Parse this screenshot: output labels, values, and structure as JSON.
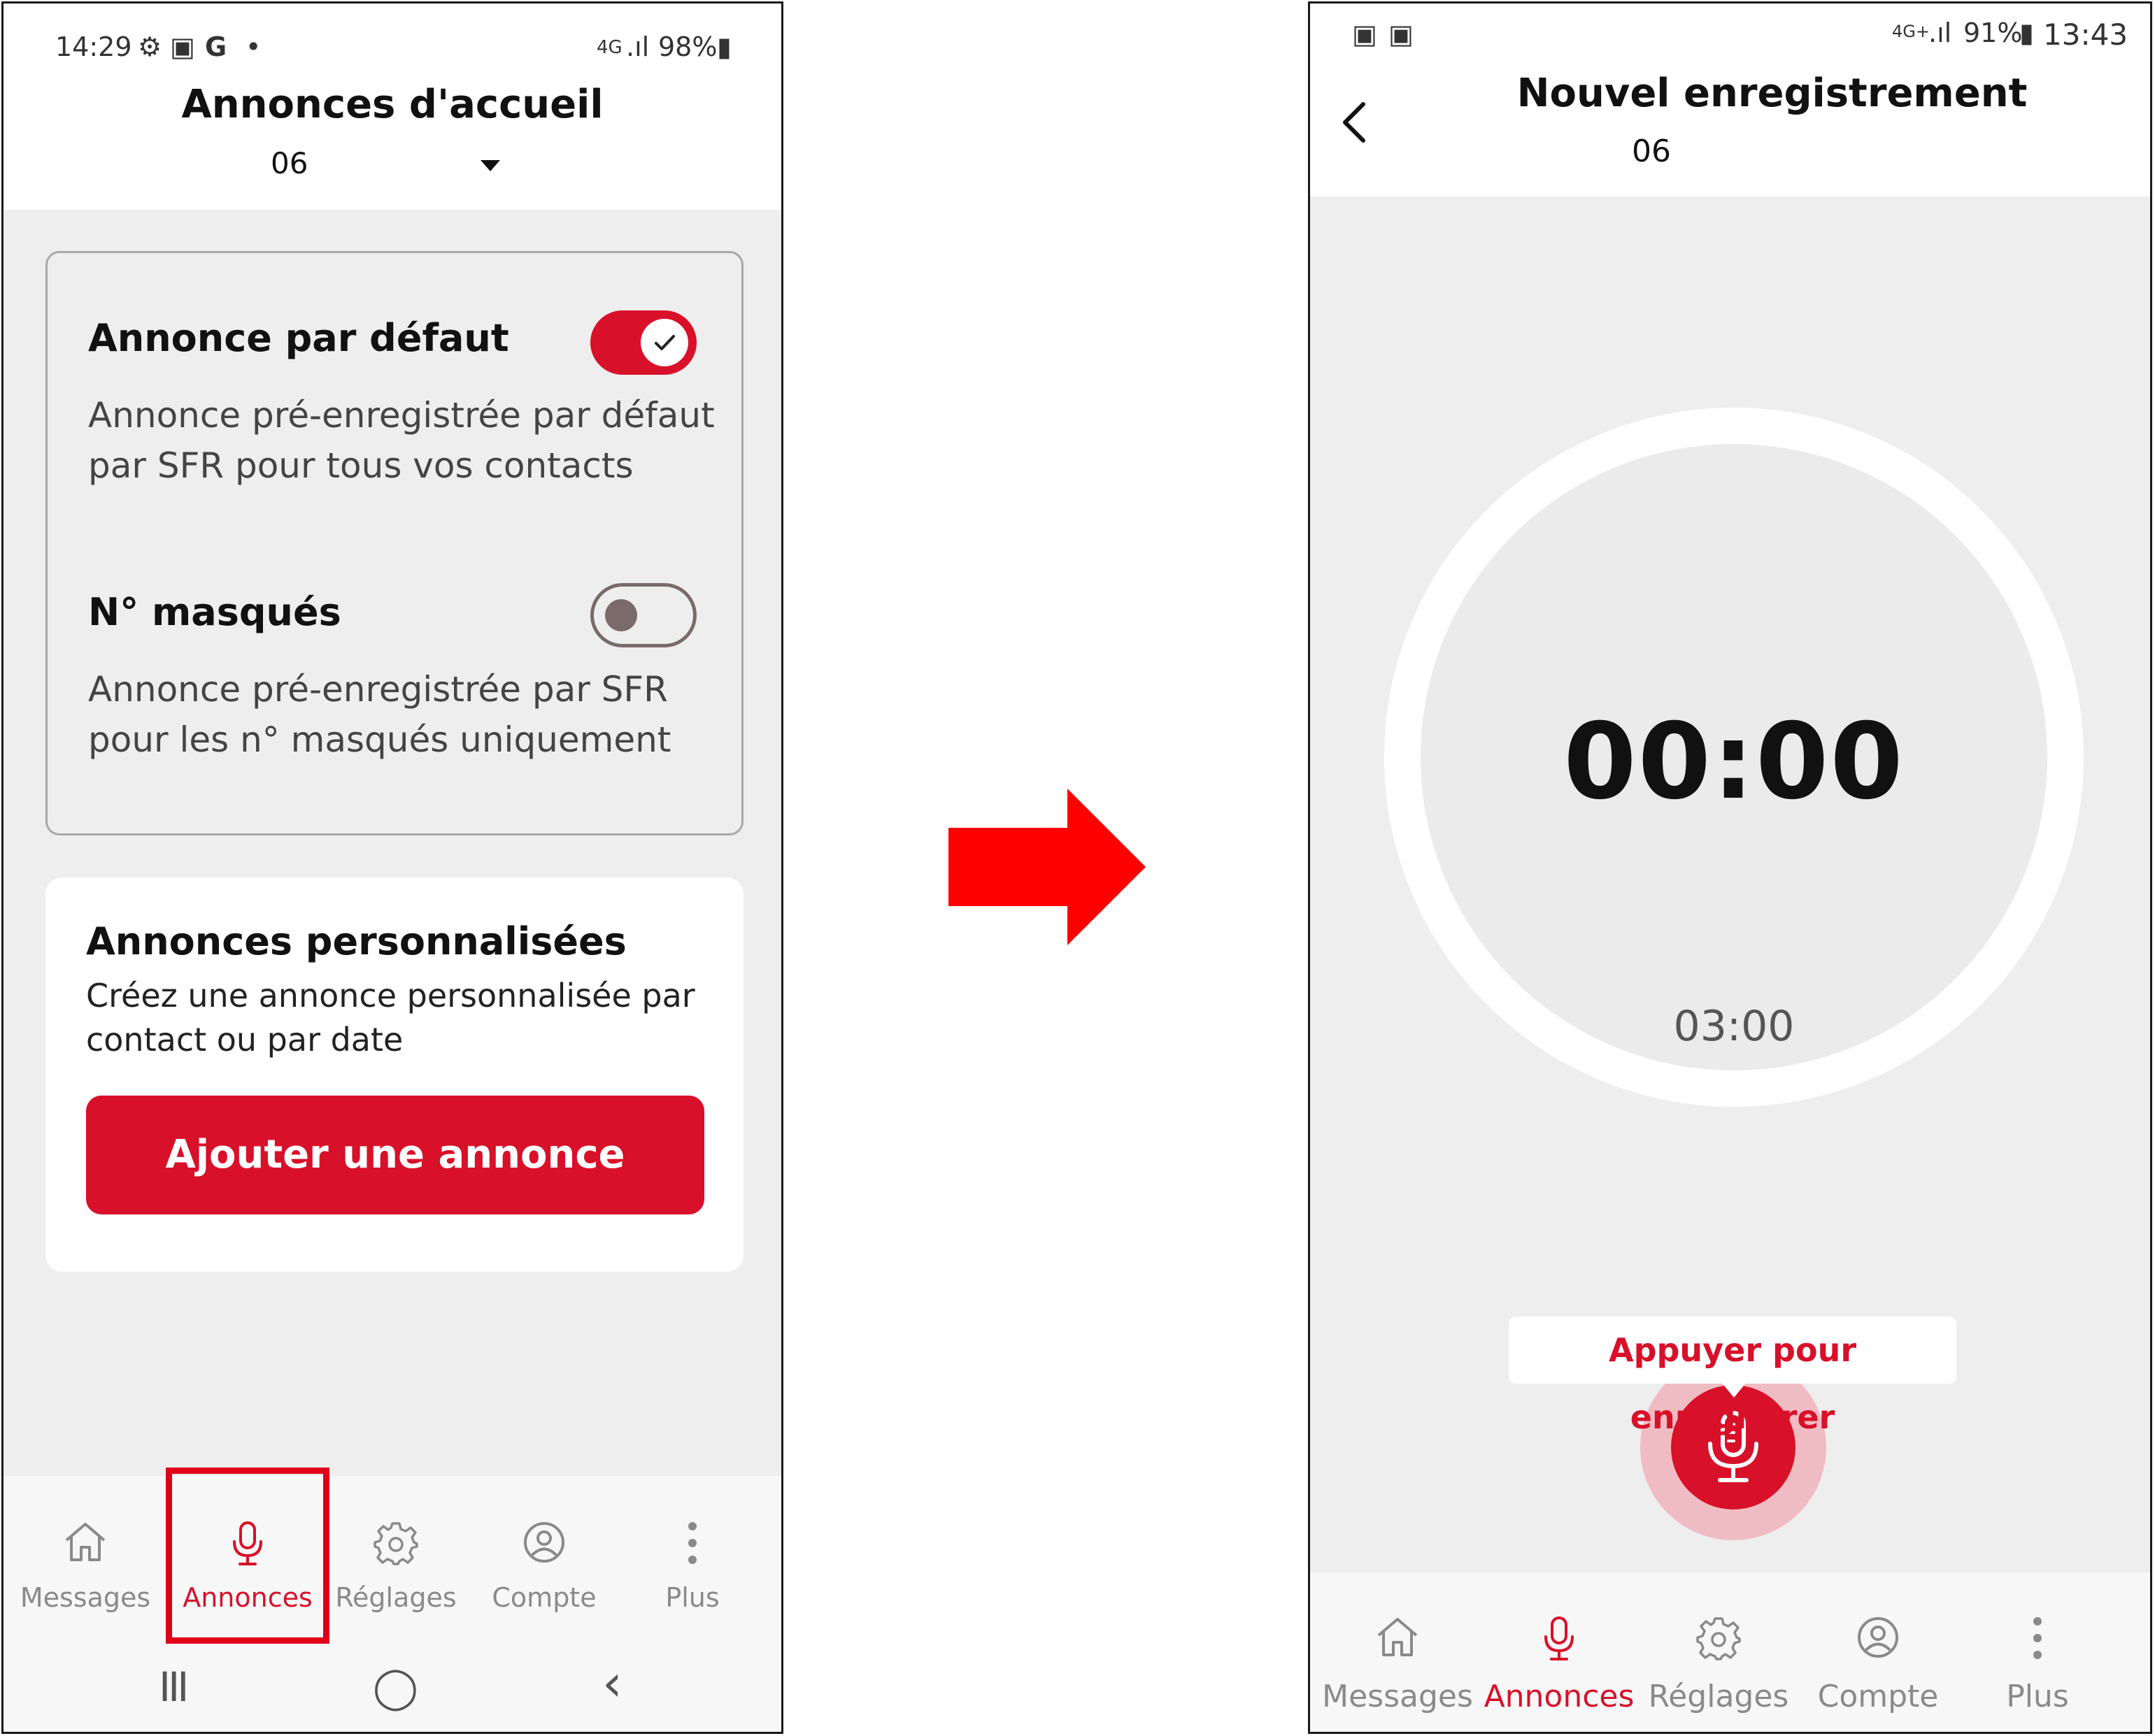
{
  "left_screen": {
    "status": {
      "time": "14:29",
      "network": "4G",
      "battery": "98%"
    },
    "header": {
      "title": "Annonces d'accueil",
      "line_number": "06"
    },
    "default_card": {
      "option1": {
        "title": "Annonce par défaut",
        "description": "Annonce pré-enregistrée par défaut par SFR pour tous vos contacts",
        "enabled": true
      },
      "option2": {
        "title": "N° masqués",
        "description": "Annonce pré-enregistrée par SFR pour les n° masqués uniquement",
        "enabled": false
      }
    },
    "custom_card": {
      "title": "Annonces personnalisées",
      "description": "Créez une annonce personnalisée par contact ou par date",
      "button_label": "Ajouter une annonce"
    },
    "nav": [
      {
        "label": "Messages",
        "icon": "home-icon"
      },
      {
        "label": "Annonces",
        "icon": "microphone-icon",
        "active": true
      },
      {
        "label": "Réglages",
        "icon": "gear-icon"
      },
      {
        "label": "Compte",
        "icon": "account-icon"
      },
      {
        "label": "Plus",
        "icon": "more-vertical-icon"
      }
    ],
    "system_nav": {
      "recents": "III",
      "home": "◯",
      "back": "‹"
    }
  },
  "right_screen": {
    "status": {
      "time": "13:43",
      "network": "4G+",
      "battery": "91%"
    },
    "header": {
      "title": "Nouvel enregistrement",
      "line_number": "06"
    },
    "timer": {
      "elapsed": "00:00",
      "max": "03:00"
    },
    "record_hint": "Appuyer pour enregistrer",
    "nav": [
      {
        "label": "Messages",
        "icon": "home-icon"
      },
      {
        "label": "Annonces",
        "icon": "microphone-icon",
        "active": true
      },
      {
        "label": "Réglages",
        "icon": "gear-icon"
      },
      {
        "label": "Compte",
        "icon": "account-icon"
      },
      {
        "label": "Plus",
        "icon": "more-vertical-icon"
      }
    ]
  },
  "colors": {
    "accent": "#d81029",
    "highlight": "#e0001a",
    "arrow": "#ff0000"
  }
}
